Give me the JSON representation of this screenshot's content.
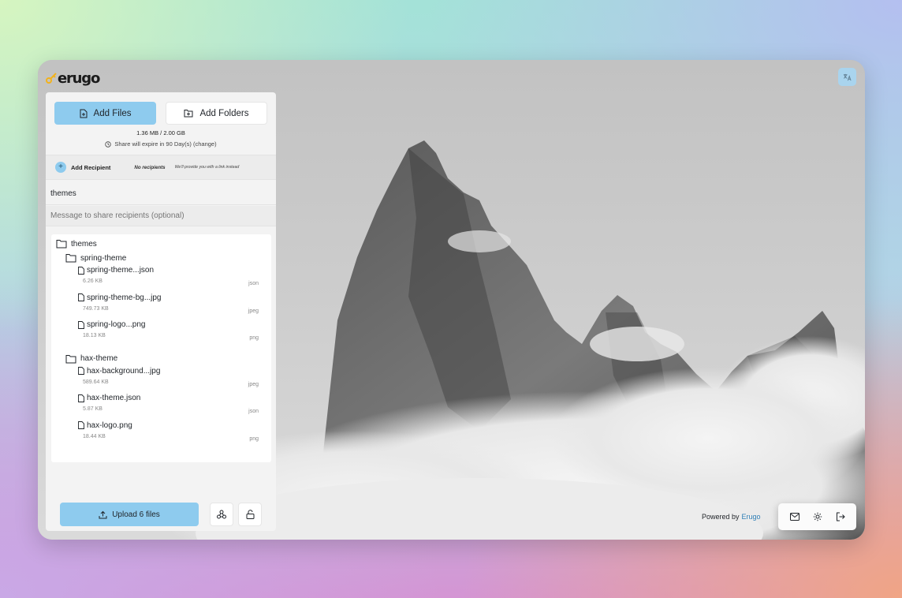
{
  "brand": {
    "name": "erugo"
  },
  "toolbar": {
    "add_files": "Add Files",
    "add_folders": "Add Folders"
  },
  "usage": {
    "text": "1.36 MB / 2.00 GB"
  },
  "expiry": {
    "text": "Share will expire in 90 Day(s) (change)"
  },
  "recipients": {
    "add_label": "Add Recipient",
    "empty_label": "No recipients",
    "note": "We'll provide you with a link instead"
  },
  "share": {
    "name_value": "themes",
    "message_placeholder": "Message to share recipients (optional)"
  },
  "tree": {
    "root": "themes",
    "folders": [
      {
        "name": "spring-theme",
        "files": [
          {
            "name": "spring-theme...json",
            "size": "6.26 KB",
            "type": "json"
          },
          {
            "name": "spring-theme-bg...jpg",
            "size": "749.73 KB",
            "type": "jpeg"
          },
          {
            "name": "spring-logo...png",
            "size": "18.13 KB",
            "type": "png"
          }
        ]
      },
      {
        "name": "hax-theme",
        "files": [
          {
            "name": "hax-background...jpg",
            "size": "589.64 KB",
            "type": "jpeg"
          },
          {
            "name": "hax-theme.json",
            "size": "5.87 KB",
            "type": "json"
          },
          {
            "name": "hax-logo.png",
            "size": "18.44 KB",
            "type": "png"
          }
        ]
      }
    ]
  },
  "upload": {
    "label": "Upload 6 files"
  },
  "footer": {
    "powered_by": "Powered by",
    "link": "Erugo"
  },
  "icons": {
    "translate": "translate-icon",
    "file": "file-icon",
    "folder": "folder-icon",
    "upload": "upload-icon",
    "share_network": "share-network-icon",
    "lock": "unlock-icon",
    "mail": "mail-icon",
    "settings": "gear-icon",
    "logout": "logout-icon"
  },
  "colors": {
    "accent": "#8ecbee",
    "link": "#2f7fb6",
    "logo_accent": "#f2b21b"
  }
}
